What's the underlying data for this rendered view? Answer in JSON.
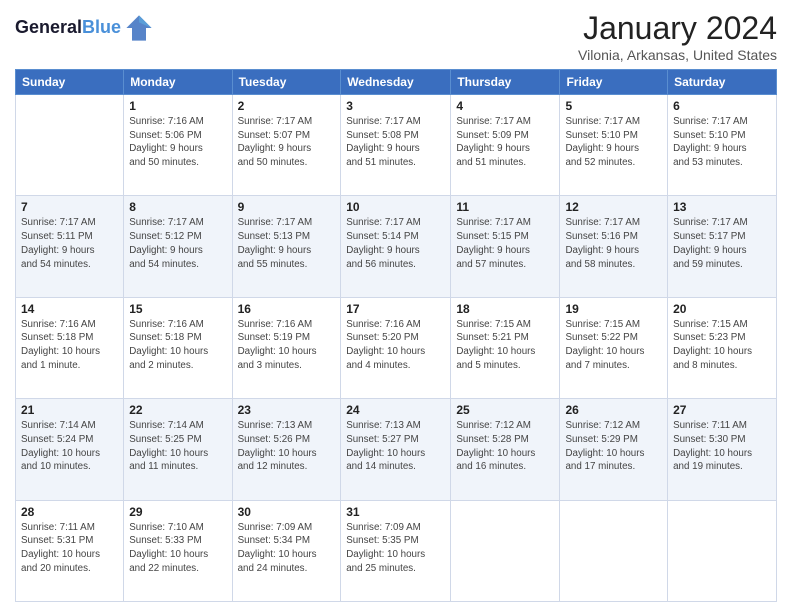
{
  "header": {
    "logo_line1": "General",
    "logo_line2": "Blue",
    "month": "January 2024",
    "location": "Vilonia, Arkansas, United States"
  },
  "weekdays": [
    "Sunday",
    "Monday",
    "Tuesday",
    "Wednesday",
    "Thursday",
    "Friday",
    "Saturday"
  ],
  "weeks": [
    [
      {
        "day": "",
        "info": ""
      },
      {
        "day": "1",
        "info": "Sunrise: 7:16 AM\nSunset: 5:06 PM\nDaylight: 9 hours\nand 50 minutes."
      },
      {
        "day": "2",
        "info": "Sunrise: 7:17 AM\nSunset: 5:07 PM\nDaylight: 9 hours\nand 50 minutes."
      },
      {
        "day": "3",
        "info": "Sunrise: 7:17 AM\nSunset: 5:08 PM\nDaylight: 9 hours\nand 51 minutes."
      },
      {
        "day": "4",
        "info": "Sunrise: 7:17 AM\nSunset: 5:09 PM\nDaylight: 9 hours\nand 51 minutes."
      },
      {
        "day": "5",
        "info": "Sunrise: 7:17 AM\nSunset: 5:10 PM\nDaylight: 9 hours\nand 52 minutes."
      },
      {
        "day": "6",
        "info": "Sunrise: 7:17 AM\nSunset: 5:10 PM\nDaylight: 9 hours\nand 53 minutes."
      }
    ],
    [
      {
        "day": "7",
        "info": "Sunrise: 7:17 AM\nSunset: 5:11 PM\nDaylight: 9 hours\nand 54 minutes."
      },
      {
        "day": "8",
        "info": "Sunrise: 7:17 AM\nSunset: 5:12 PM\nDaylight: 9 hours\nand 54 minutes."
      },
      {
        "day": "9",
        "info": "Sunrise: 7:17 AM\nSunset: 5:13 PM\nDaylight: 9 hours\nand 55 minutes."
      },
      {
        "day": "10",
        "info": "Sunrise: 7:17 AM\nSunset: 5:14 PM\nDaylight: 9 hours\nand 56 minutes."
      },
      {
        "day": "11",
        "info": "Sunrise: 7:17 AM\nSunset: 5:15 PM\nDaylight: 9 hours\nand 57 minutes."
      },
      {
        "day": "12",
        "info": "Sunrise: 7:17 AM\nSunset: 5:16 PM\nDaylight: 9 hours\nand 58 minutes."
      },
      {
        "day": "13",
        "info": "Sunrise: 7:17 AM\nSunset: 5:17 PM\nDaylight: 9 hours\nand 59 minutes."
      }
    ],
    [
      {
        "day": "14",
        "info": "Sunrise: 7:16 AM\nSunset: 5:18 PM\nDaylight: 10 hours\nand 1 minute."
      },
      {
        "day": "15",
        "info": "Sunrise: 7:16 AM\nSunset: 5:18 PM\nDaylight: 10 hours\nand 2 minutes."
      },
      {
        "day": "16",
        "info": "Sunrise: 7:16 AM\nSunset: 5:19 PM\nDaylight: 10 hours\nand 3 minutes."
      },
      {
        "day": "17",
        "info": "Sunrise: 7:16 AM\nSunset: 5:20 PM\nDaylight: 10 hours\nand 4 minutes."
      },
      {
        "day": "18",
        "info": "Sunrise: 7:15 AM\nSunset: 5:21 PM\nDaylight: 10 hours\nand 5 minutes."
      },
      {
        "day": "19",
        "info": "Sunrise: 7:15 AM\nSunset: 5:22 PM\nDaylight: 10 hours\nand 7 minutes."
      },
      {
        "day": "20",
        "info": "Sunrise: 7:15 AM\nSunset: 5:23 PM\nDaylight: 10 hours\nand 8 minutes."
      }
    ],
    [
      {
        "day": "21",
        "info": "Sunrise: 7:14 AM\nSunset: 5:24 PM\nDaylight: 10 hours\nand 10 minutes."
      },
      {
        "day": "22",
        "info": "Sunrise: 7:14 AM\nSunset: 5:25 PM\nDaylight: 10 hours\nand 11 minutes."
      },
      {
        "day": "23",
        "info": "Sunrise: 7:13 AM\nSunset: 5:26 PM\nDaylight: 10 hours\nand 12 minutes."
      },
      {
        "day": "24",
        "info": "Sunrise: 7:13 AM\nSunset: 5:27 PM\nDaylight: 10 hours\nand 14 minutes."
      },
      {
        "day": "25",
        "info": "Sunrise: 7:12 AM\nSunset: 5:28 PM\nDaylight: 10 hours\nand 16 minutes."
      },
      {
        "day": "26",
        "info": "Sunrise: 7:12 AM\nSunset: 5:29 PM\nDaylight: 10 hours\nand 17 minutes."
      },
      {
        "day": "27",
        "info": "Sunrise: 7:11 AM\nSunset: 5:30 PM\nDaylight: 10 hours\nand 19 minutes."
      }
    ],
    [
      {
        "day": "28",
        "info": "Sunrise: 7:11 AM\nSunset: 5:31 PM\nDaylight: 10 hours\nand 20 minutes."
      },
      {
        "day": "29",
        "info": "Sunrise: 7:10 AM\nSunset: 5:33 PM\nDaylight: 10 hours\nand 22 minutes."
      },
      {
        "day": "30",
        "info": "Sunrise: 7:09 AM\nSunset: 5:34 PM\nDaylight: 10 hours\nand 24 minutes."
      },
      {
        "day": "31",
        "info": "Sunrise: 7:09 AM\nSunset: 5:35 PM\nDaylight: 10 hours\nand 25 minutes."
      },
      {
        "day": "",
        "info": ""
      },
      {
        "day": "",
        "info": ""
      },
      {
        "day": "",
        "info": ""
      }
    ]
  ]
}
